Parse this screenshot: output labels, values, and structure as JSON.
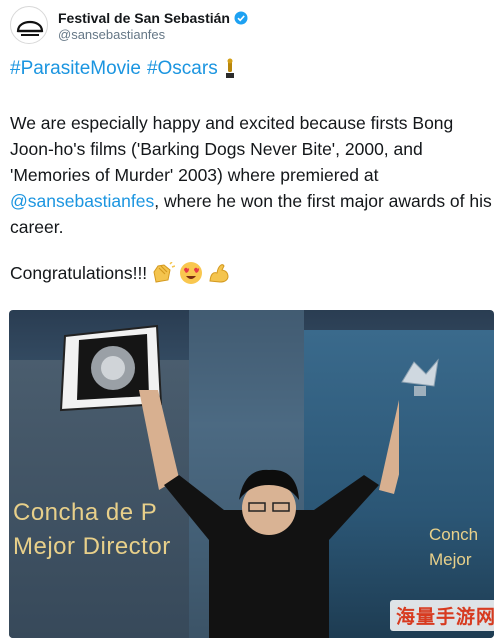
{
  "account": {
    "display_name": "Festival de San Sebastián",
    "handle": "@sansebastianfes"
  },
  "tweet": {
    "hashtag_1": "#ParasiteMovie",
    "hashtag_2": "#Oscars",
    "text_before_mention": "We are especially happy and excited because firsts Bong Joon-ho's films ('Barking Dogs Never Bite', 2000, and 'Memories of Murder' 2003) where premiered at ",
    "mention": "@sansebastianfes",
    "text_after_mention": ", where he won the first major awards of his career.",
    "congrats": "Congratulations!!!"
  },
  "photo": {
    "sign_left_line1": "Concha de P",
    "sign_left_line2": "Mejor Director",
    "sign_right_line1": "Conch",
    "sign_right_line2": "Mejor"
  },
  "watermark": "海量手游网",
  "colors": {
    "link": "#1b95e0",
    "verified": "#1da1f2",
    "text": "#14171a",
    "muted": "#657786",
    "watermark": "#d73b20"
  },
  "icons": {
    "avatar": "shell-logo-icon",
    "verified": "verified-badge-icon",
    "trophy": "trophy-icon",
    "clap": "clapping-hands-icon",
    "heart_eyes": "heart-eyes-icon",
    "flex": "flexed-biceps-icon"
  }
}
